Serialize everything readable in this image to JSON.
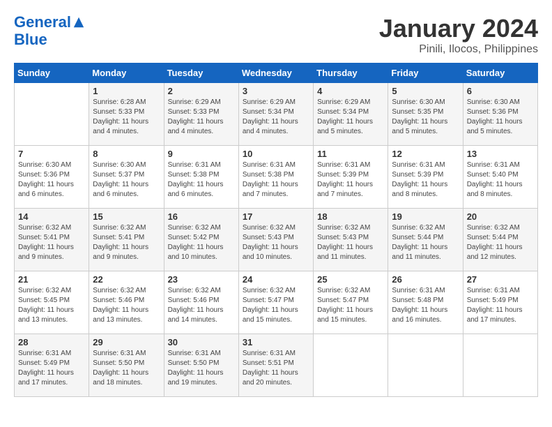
{
  "header": {
    "logo_line1": "General",
    "logo_line2": "Blue",
    "month": "January 2024",
    "location": "Pinili, Ilocos, Philippines"
  },
  "days_of_week": [
    "Sunday",
    "Monday",
    "Tuesday",
    "Wednesday",
    "Thursday",
    "Friday",
    "Saturday"
  ],
  "weeks": [
    [
      {
        "day": "",
        "sunrise": "",
        "sunset": "",
        "daylight": ""
      },
      {
        "day": "1",
        "sunrise": "Sunrise: 6:28 AM",
        "sunset": "Sunset: 5:33 PM",
        "daylight": "Daylight: 11 hours and 4 minutes."
      },
      {
        "day": "2",
        "sunrise": "Sunrise: 6:29 AM",
        "sunset": "Sunset: 5:33 PM",
        "daylight": "Daylight: 11 hours and 4 minutes."
      },
      {
        "day": "3",
        "sunrise": "Sunrise: 6:29 AM",
        "sunset": "Sunset: 5:34 PM",
        "daylight": "Daylight: 11 hours and 4 minutes."
      },
      {
        "day": "4",
        "sunrise": "Sunrise: 6:29 AM",
        "sunset": "Sunset: 5:34 PM",
        "daylight": "Daylight: 11 hours and 5 minutes."
      },
      {
        "day": "5",
        "sunrise": "Sunrise: 6:30 AM",
        "sunset": "Sunset: 5:35 PM",
        "daylight": "Daylight: 11 hours and 5 minutes."
      },
      {
        "day": "6",
        "sunrise": "Sunrise: 6:30 AM",
        "sunset": "Sunset: 5:36 PM",
        "daylight": "Daylight: 11 hours and 5 minutes."
      }
    ],
    [
      {
        "day": "7",
        "sunrise": "Sunrise: 6:30 AM",
        "sunset": "Sunset: 5:36 PM",
        "daylight": "Daylight: 11 hours and 6 minutes."
      },
      {
        "day": "8",
        "sunrise": "Sunrise: 6:30 AM",
        "sunset": "Sunset: 5:37 PM",
        "daylight": "Daylight: 11 hours and 6 minutes."
      },
      {
        "day": "9",
        "sunrise": "Sunrise: 6:31 AM",
        "sunset": "Sunset: 5:38 PM",
        "daylight": "Daylight: 11 hours and 6 minutes."
      },
      {
        "day": "10",
        "sunrise": "Sunrise: 6:31 AM",
        "sunset": "Sunset: 5:38 PM",
        "daylight": "Daylight: 11 hours and 7 minutes."
      },
      {
        "day": "11",
        "sunrise": "Sunrise: 6:31 AM",
        "sunset": "Sunset: 5:39 PM",
        "daylight": "Daylight: 11 hours and 7 minutes."
      },
      {
        "day": "12",
        "sunrise": "Sunrise: 6:31 AM",
        "sunset": "Sunset: 5:39 PM",
        "daylight": "Daylight: 11 hours and 8 minutes."
      },
      {
        "day": "13",
        "sunrise": "Sunrise: 6:31 AM",
        "sunset": "Sunset: 5:40 PM",
        "daylight": "Daylight: 11 hours and 8 minutes."
      }
    ],
    [
      {
        "day": "14",
        "sunrise": "Sunrise: 6:32 AM",
        "sunset": "Sunset: 5:41 PM",
        "daylight": "Daylight: 11 hours and 9 minutes."
      },
      {
        "day": "15",
        "sunrise": "Sunrise: 6:32 AM",
        "sunset": "Sunset: 5:41 PM",
        "daylight": "Daylight: 11 hours and 9 minutes."
      },
      {
        "day": "16",
        "sunrise": "Sunrise: 6:32 AM",
        "sunset": "Sunset: 5:42 PM",
        "daylight": "Daylight: 11 hours and 10 minutes."
      },
      {
        "day": "17",
        "sunrise": "Sunrise: 6:32 AM",
        "sunset": "Sunset: 5:43 PM",
        "daylight": "Daylight: 11 hours and 10 minutes."
      },
      {
        "day": "18",
        "sunrise": "Sunrise: 6:32 AM",
        "sunset": "Sunset: 5:43 PM",
        "daylight": "Daylight: 11 hours and 11 minutes."
      },
      {
        "day": "19",
        "sunrise": "Sunrise: 6:32 AM",
        "sunset": "Sunset: 5:44 PM",
        "daylight": "Daylight: 11 hours and 11 minutes."
      },
      {
        "day": "20",
        "sunrise": "Sunrise: 6:32 AM",
        "sunset": "Sunset: 5:44 PM",
        "daylight": "Daylight: 11 hours and 12 minutes."
      }
    ],
    [
      {
        "day": "21",
        "sunrise": "Sunrise: 6:32 AM",
        "sunset": "Sunset: 5:45 PM",
        "daylight": "Daylight: 11 hours and 13 minutes."
      },
      {
        "day": "22",
        "sunrise": "Sunrise: 6:32 AM",
        "sunset": "Sunset: 5:46 PM",
        "daylight": "Daylight: 11 hours and 13 minutes."
      },
      {
        "day": "23",
        "sunrise": "Sunrise: 6:32 AM",
        "sunset": "Sunset: 5:46 PM",
        "daylight": "Daylight: 11 hours and 14 minutes."
      },
      {
        "day": "24",
        "sunrise": "Sunrise: 6:32 AM",
        "sunset": "Sunset: 5:47 PM",
        "daylight": "Daylight: 11 hours and 15 minutes."
      },
      {
        "day": "25",
        "sunrise": "Sunrise: 6:32 AM",
        "sunset": "Sunset: 5:47 PM",
        "daylight": "Daylight: 11 hours and 15 minutes."
      },
      {
        "day": "26",
        "sunrise": "Sunrise: 6:31 AM",
        "sunset": "Sunset: 5:48 PM",
        "daylight": "Daylight: 11 hours and 16 minutes."
      },
      {
        "day": "27",
        "sunrise": "Sunrise: 6:31 AM",
        "sunset": "Sunset: 5:49 PM",
        "daylight": "Daylight: 11 hours and 17 minutes."
      }
    ],
    [
      {
        "day": "28",
        "sunrise": "Sunrise: 6:31 AM",
        "sunset": "Sunset: 5:49 PM",
        "daylight": "Daylight: 11 hours and 17 minutes."
      },
      {
        "day": "29",
        "sunrise": "Sunrise: 6:31 AM",
        "sunset": "Sunset: 5:50 PM",
        "daylight": "Daylight: 11 hours and 18 minutes."
      },
      {
        "day": "30",
        "sunrise": "Sunrise: 6:31 AM",
        "sunset": "Sunset: 5:50 PM",
        "daylight": "Daylight: 11 hours and 19 minutes."
      },
      {
        "day": "31",
        "sunrise": "Sunrise: 6:31 AM",
        "sunset": "Sunset: 5:51 PM",
        "daylight": "Daylight: 11 hours and 20 minutes."
      },
      {
        "day": "",
        "sunrise": "",
        "sunset": "",
        "daylight": ""
      },
      {
        "day": "",
        "sunrise": "",
        "sunset": "",
        "daylight": ""
      },
      {
        "day": "",
        "sunrise": "",
        "sunset": "",
        "daylight": ""
      }
    ]
  ]
}
